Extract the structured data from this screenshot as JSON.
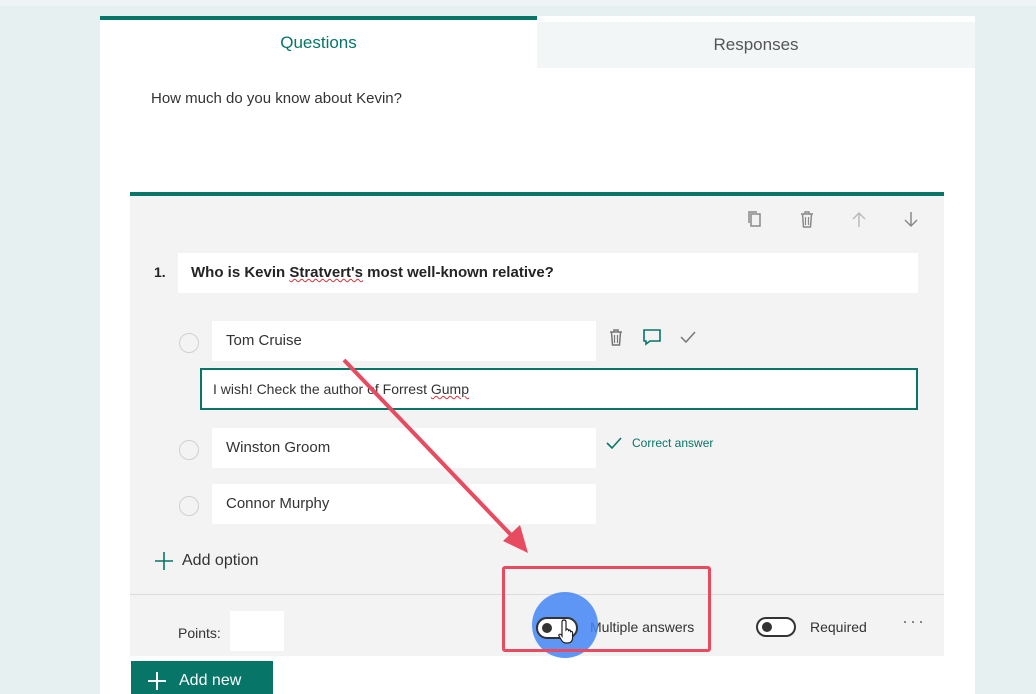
{
  "tabs": {
    "questions": "Questions",
    "responses": "Responses"
  },
  "form": {
    "title": "How much do you know about Kevin?"
  },
  "question": {
    "number": "1.",
    "text_before": "Who is Kevin ",
    "text_wavy": "Stratvert's",
    "text_after": " most well-known relative?",
    "options": [
      {
        "label": "Tom Cruise"
      },
      {
        "label": "Winston Groom"
      },
      {
        "label": "Connor Murphy"
      }
    ],
    "feedback_before": "I wish! Check the author of Forrest ",
    "feedback_wavy": "Gump",
    "correct_label": "Correct answer",
    "add_option": "Add option"
  },
  "footer": {
    "points_label": "Points:",
    "multiple_answers_label": "Multiple answers",
    "required_label": "Required",
    "more": "···"
  },
  "add_new": "Add new",
  "colors": {
    "accent": "#077568",
    "highlight": "#e84a5f",
    "cursor": "#4285f4"
  }
}
